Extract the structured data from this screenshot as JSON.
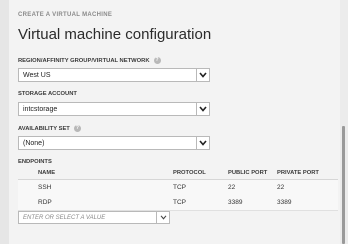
{
  "header": {
    "eyebrow": "CREATE A VIRTUAL MACHINE",
    "title": "Virtual machine configuration"
  },
  "region": {
    "label": "REGION/AFFINITY GROUP/VIRTUAL NETWORK",
    "value": "West US",
    "help_icon": "question-icon"
  },
  "storage": {
    "label": "STORAGE ACCOUNT",
    "value": "intcstorage"
  },
  "availability": {
    "label": "AVAILABILITY SET",
    "value": "(None)",
    "help_icon": "question-icon"
  },
  "endpoints": {
    "label": "ENDPOINTS",
    "columns": {
      "name": "NAME",
      "protocol": "PROTOCOL",
      "public_port": "PUBLIC PORT",
      "private_port": "PRIVATE PORT"
    },
    "rows": [
      {
        "name": "SSH",
        "protocol": "TCP",
        "public_port": "22",
        "private_port": "22"
      },
      {
        "name": "RDP",
        "protocol": "TCP",
        "public_port": "3389",
        "private_port": "3389"
      }
    ],
    "combo_placeholder": "ENTER OR SELECT A VALUE"
  },
  "colors": {
    "background": "#f3f3f3",
    "border": "#b9b9b9",
    "text": "#2b2b2b"
  }
}
